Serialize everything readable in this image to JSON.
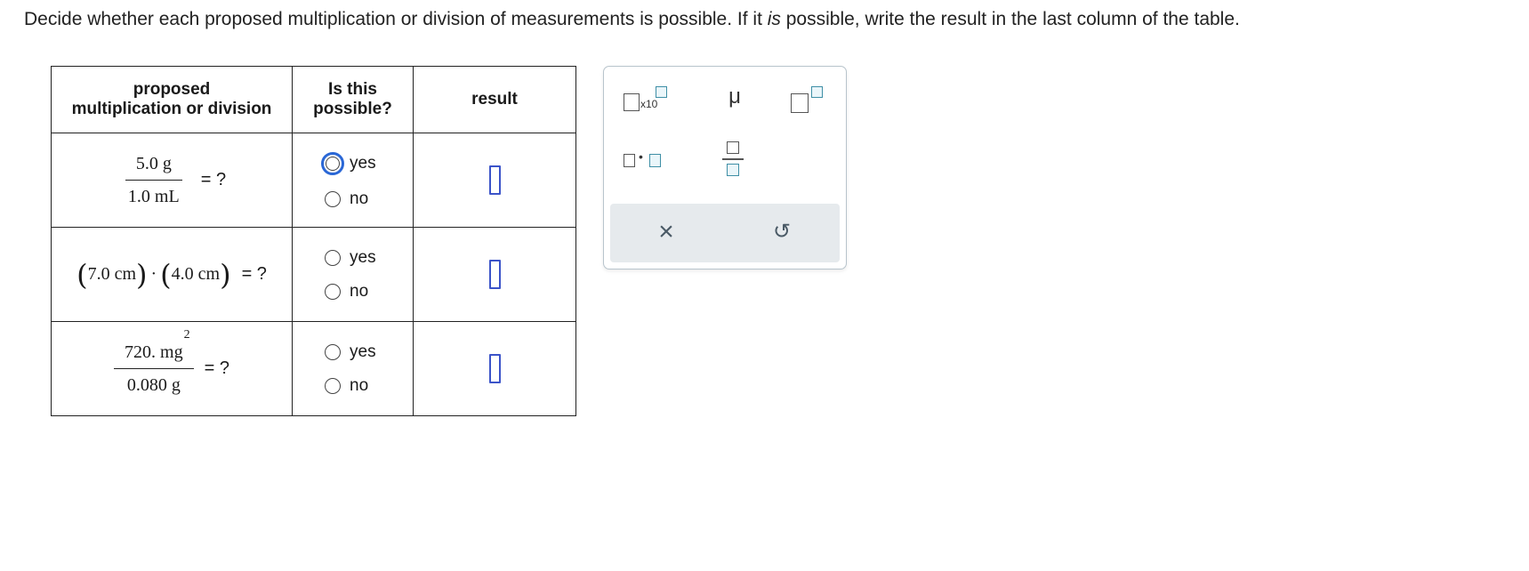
{
  "instructions": {
    "part1": "Decide whether each proposed multiplication or division of measurements is possible. If it ",
    "emph": "is",
    "part2": " possible, write the result in the last column of the table."
  },
  "table": {
    "headers": {
      "col1_line1": "proposed",
      "col1_line2": "multiplication or division",
      "col2_line1": "Is this",
      "col2_line2": "possible?",
      "col3": "result"
    },
    "rows": [
      {
        "num": "5.0 g",
        "den": "1.0 mL",
        "eq": "= ?",
        "options": [
          "yes",
          "no"
        ]
      },
      {
        "factor1": "7.0 cm",
        "dot": "·",
        "factor2": "4.0 cm",
        "eq": "= ?",
        "options": [
          "yes",
          "no"
        ]
      },
      {
        "num": "720. mg",
        "num_exp": "2",
        "den": "0.080 g",
        "eq": "= ?",
        "options": [
          "yes",
          "no"
        ]
      }
    ]
  },
  "palette": {
    "sci_label": "x10",
    "mu": "μ",
    "clear_symbol": "×",
    "undo_symbol": "↺",
    "mult_dot": "•"
  },
  "colors": {
    "focus_ring": "#2a67d6",
    "answer_box": "#3c54c9",
    "palette_teal": "#3f8fa6"
  }
}
